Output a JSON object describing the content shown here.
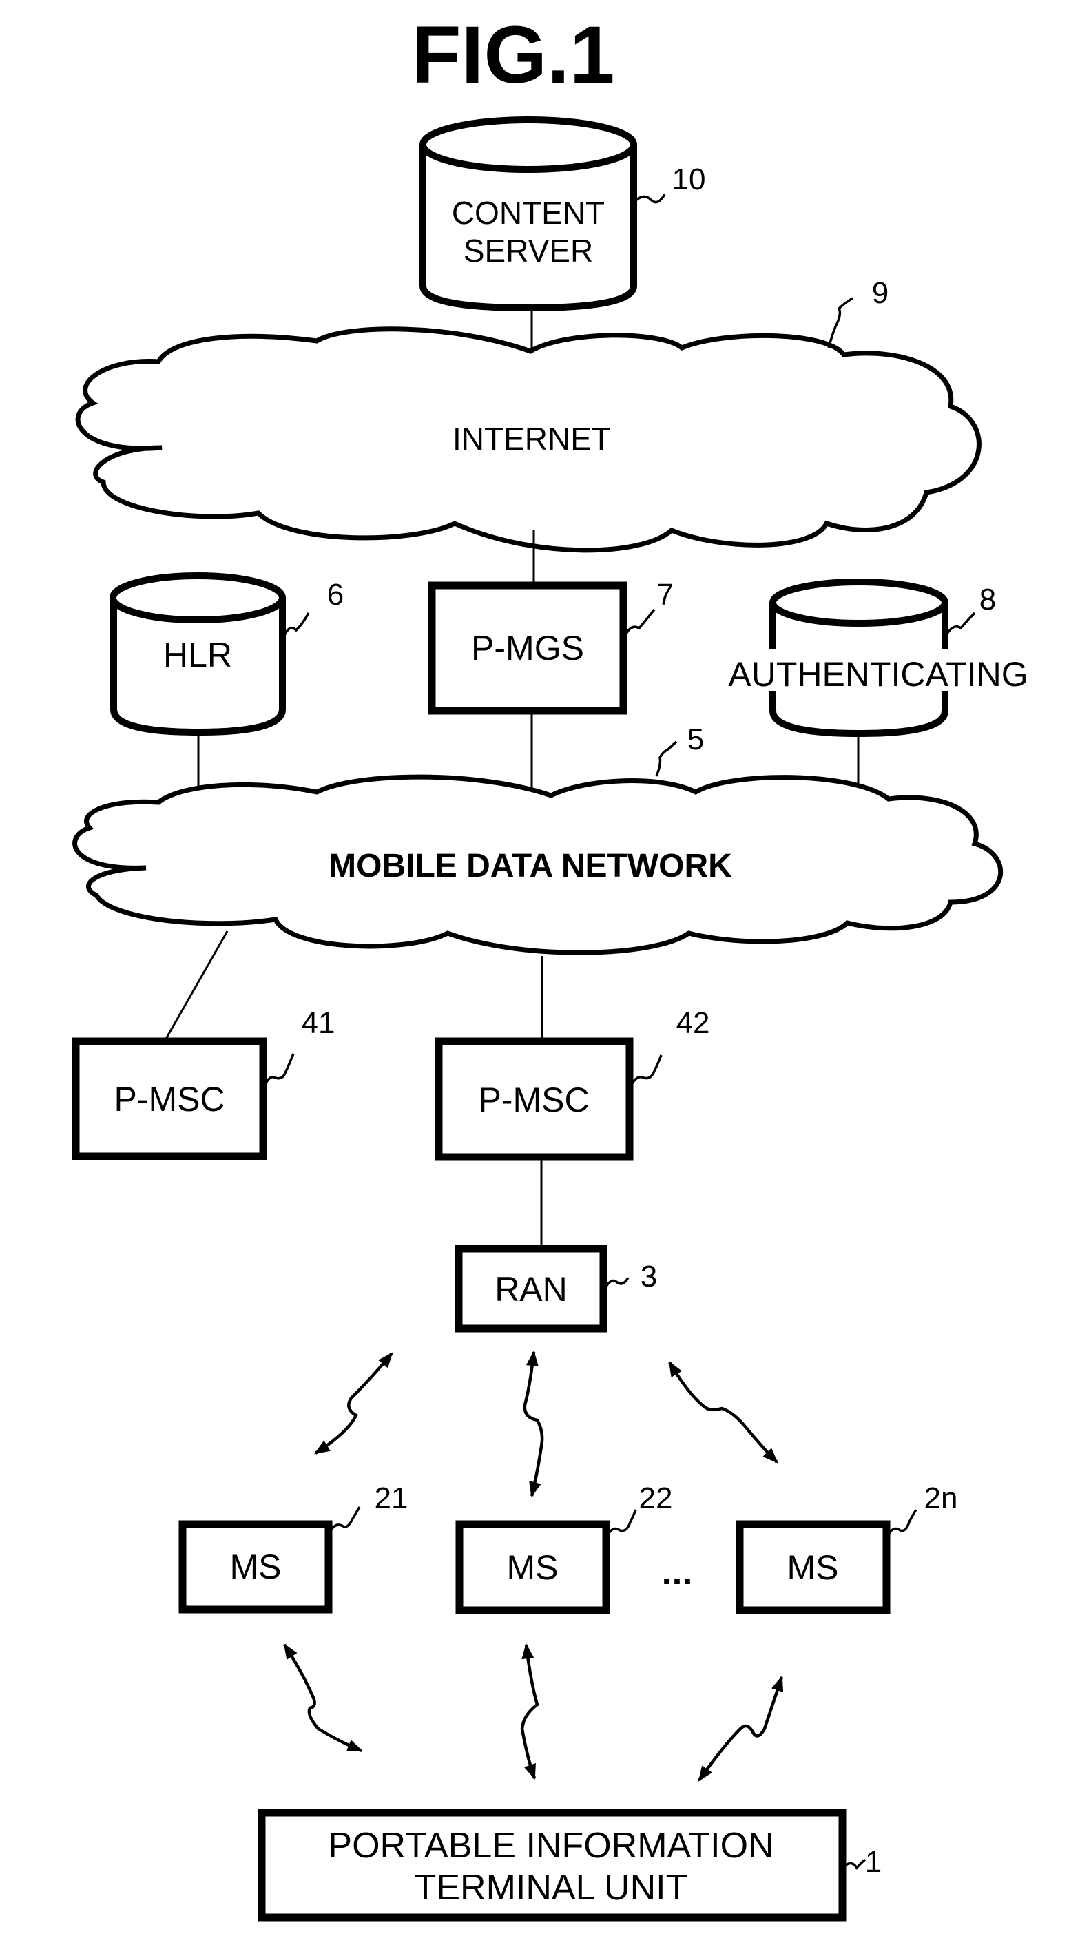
{
  "figure": {
    "title": "FIG.1"
  },
  "nodes": {
    "content_server": {
      "line1": "CONTENT",
      "line2": "SERVER",
      "ref": "10"
    },
    "internet": {
      "label": "INTERNET",
      "ref": "9"
    },
    "hlr": {
      "label": "HLR",
      "ref": "6"
    },
    "p_mgs": {
      "label": "P-MGS",
      "ref": "7"
    },
    "authenticating": {
      "label": "AUTHENTICATING",
      "ref": "8"
    },
    "mobile_data_network": {
      "label": "MOBILE DATA NETWORK",
      "ref": "5"
    },
    "p_msc_41": {
      "label": "P-MSC",
      "ref": "41"
    },
    "p_msc_42": {
      "label": "P-MSC",
      "ref": "42"
    },
    "ran": {
      "label": "RAN",
      "ref": "3"
    },
    "ms_21": {
      "label": "MS",
      "ref": "21"
    },
    "ms_22": {
      "label": "MS",
      "ref": "22"
    },
    "ms_2n": {
      "label": "MS",
      "ref": "2n"
    },
    "ellipsis": "...",
    "terminal": {
      "line1": "PORTABLE INFORMATION",
      "line2": "TERMINAL UNIT",
      "ref": "1"
    }
  }
}
